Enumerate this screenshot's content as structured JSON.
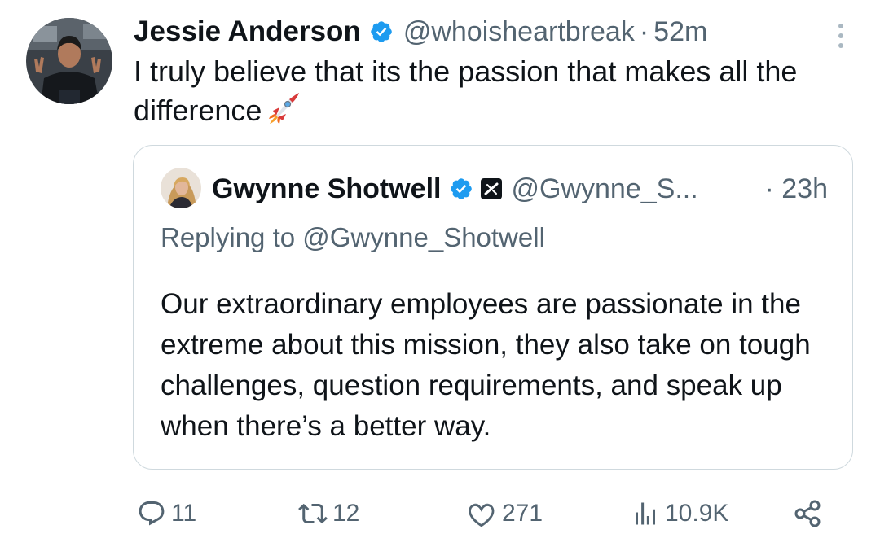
{
  "tweet": {
    "author_name": "Jessie Anderson",
    "handle": "@whoisheartbreak",
    "separator": "·",
    "time": "52m",
    "text": "I truly believe that its the passion that makes all the difference",
    "emoji": "rocket"
  },
  "quoted_tweet": {
    "author_name": "Gwynne Shotwell",
    "handle": "@Gwynne_S...",
    "time": "· 23h",
    "replying_to": "Replying to @Gwynne_Shotwell",
    "text": "Our extraordinary employees are passionate in the extreme about this mission, they also take on tough challenges, question requirements, and speak up when there’s a better way."
  },
  "actions": {
    "replies": "11",
    "reposts": "12",
    "likes": "271",
    "views": "10.9K"
  },
  "icons": {
    "verified": "verified-badge-icon",
    "affiliate": "x-affiliate-badge-icon",
    "more": "more-vertical-icon",
    "reply": "reply-icon",
    "repost": "repost-icon",
    "like": "heart-icon",
    "views": "views-icon",
    "share": "share-icon"
  },
  "colors": {
    "text": "#0f1419",
    "secondary": "#536471",
    "verified": "#1d9bf0",
    "border": "#cfd9de"
  }
}
